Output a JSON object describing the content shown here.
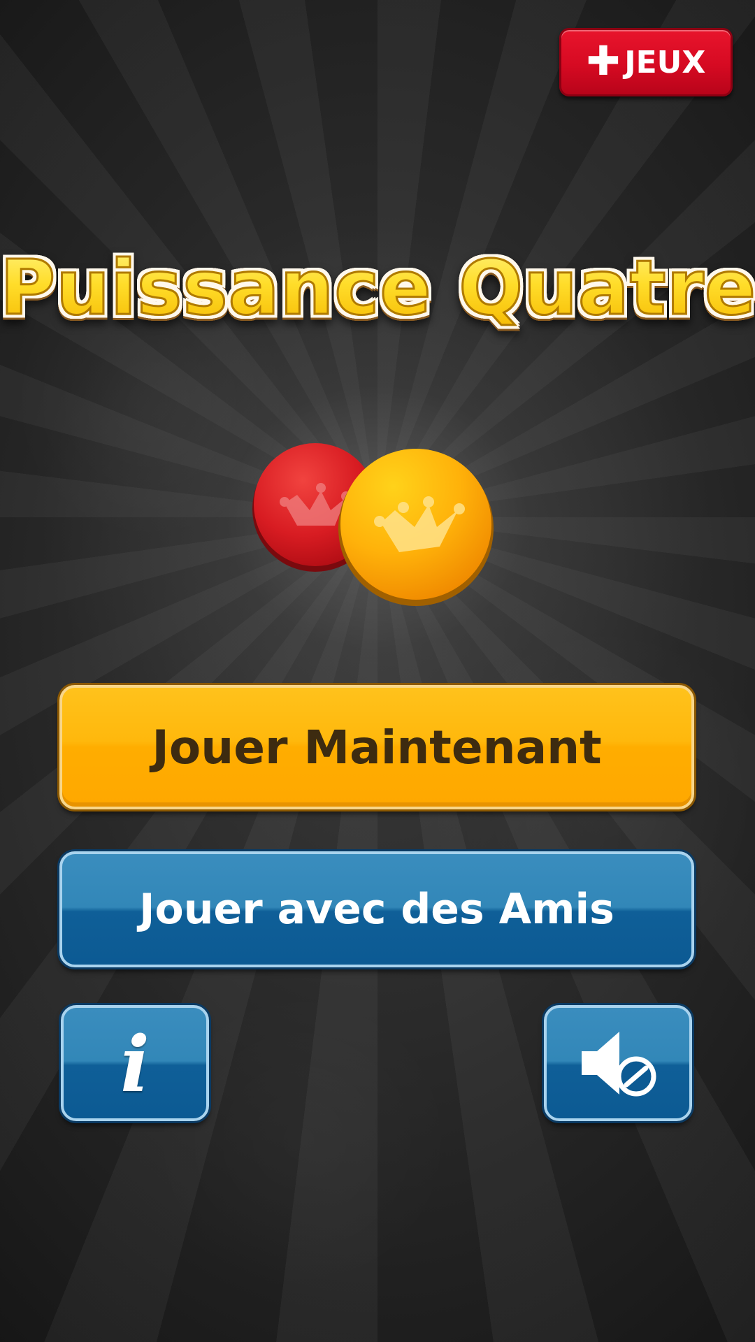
{
  "more_games": {
    "icon": "plus-icon",
    "label": "JEUX"
  },
  "title": "Puissance Quatre",
  "logo": {
    "red_token_color": "#d81c22",
    "yellow_token_color": "#ffb20a",
    "emblem": "crown-icon"
  },
  "menu": {
    "play_now_label": "Jouer Maintenant",
    "play_friends_label": "Jouer avec des Amis",
    "info_icon": "info-icon",
    "sound_icon": "sound-muted-icon"
  },
  "colors": {
    "accent_yellow": "#ffb000",
    "accent_blue": "#1a6ea8",
    "badge_red": "#d60a22"
  }
}
